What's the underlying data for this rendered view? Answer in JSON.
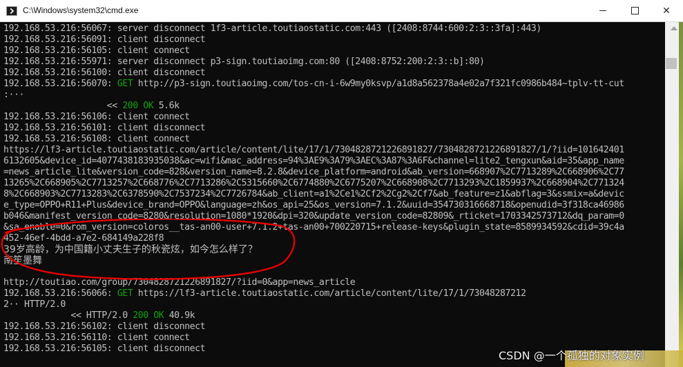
{
  "window": {
    "title": "C:\\Windows\\system32\\cmd.exe",
    "icon": "cmd-icon"
  },
  "console_lines": [
    {
      "text": "192.168.53.216:56067: server disconnect 1f3-article.toutiaostatic.com:443 ([2408:8744:600:2:3::3fa]:443)"
    },
    {
      "text": "192.168.53.216:56091: client disconnect"
    },
    {
      "text": "192.168.53.216:56105: client connect"
    },
    {
      "text": "192.168.53.216:55971: server disconnect p3-sign.toutiaoimg.com:80 ([2408:8752:200:2:3::b]:80)"
    },
    {
      "text": "192.168.53.216:56100: client disconnect"
    },
    {
      "prefix": "192.168.53.216:56070: ",
      "method": "GET",
      "text": " http://p3-sign.toutiaoimg.com/tos-cn-i-6w9my0ksvp/a1d8a562378a4e02a7f321fc0986b484~tplv-tt-cut"
    },
    {
      "text": ":···"
    },
    {
      "text": "                    << ",
      "status": "200 OK",
      "tail": " 5.6k"
    },
    {
      "text": "192.168.53.216:56106: client connect"
    },
    {
      "text": "192.168.53.216:56101: client disconnect"
    },
    {
      "text": "192.168.53.216:56108: client connect"
    },
    {
      "text": "https://lf3-article.toutiaostatic.com/article/content/lite/17/1/7304828721226891827/7304828721226891827/1/?iid=101642401"
    },
    {
      "text": "6132605&device_id=4077438183935038&ac=wifi&mac_address=94%3AE9%3A79%3AEC%3A87%3A6F&channel=lite2_tengxun&aid=35&app_name"
    },
    {
      "text": "=news_article_lite&version_code=828&version_name=8.2.8&device_platform=android&ab_version=668907%2C7713289%2C668906%2C77"
    },
    {
      "text": "13265%2C668905%2C7713257%2C668776%2C7713286%2C5315660%2C6774880%2C6775207%2C668908%2C7713293%2C1859937%2C668904%2C771324"
    },
    {
      "text": "8%2C668903%2C7713283%2C6378590%2C7537234%2C7726784&ab_client=a1%2Ce1%2Cf2%2Cg2%2Cf7&ab_feature=z1&abflag=3&ssmix=a&devic"
    },
    {
      "text": "e_type=OPPO+R11+Plus&device_brand=OPPO&language=zh&os_api=25&os_version=7.1.2&uuid=354730316668718&openudid=3f318ca46986"
    },
    {
      "text": "b046&manifest_version_code=8280&resolution=1080*1920&dpi=320&update_version_code=82809&_rticket=1703342573712&dq_param=0"
    },
    {
      "text": "&sa_enable=0&rom_version=coloros__tas-an00-user+7.1.2+tas-an00+700220715+release-keys&plugin_state=8589934592&cdid=39c4a"
    },
    {
      "text": "452-46ef-4bdd-a7e2-684149a228f8"
    },
    {
      "text": "39岁高龄，为中国籍小丈夫生子的秋瓷炫，如今怎么样了？",
      "cjk": true
    },
    {
      "text": "南笙墨舞",
      "cjk": true
    },
    {
      "text": ""
    },
    {
      "text": "http://toutiao.com/group/7304828721226891827/?iid=0&app=news_article"
    },
    {
      "prefix": "192.168.53.216:56066: ",
      "method": "GET",
      "text": " https://lf3-article.toutiaostatic.com/article/content/lite/17/1/73048287212"
    },
    {
      "text": "2·· HTTP/2.0"
    },
    {
      "text": "             << HTTP/2.0 ",
      "status": "200 OK",
      "tail": " 40.9k"
    },
    {
      "text": "192.168.53.216:56102: client disconnect"
    },
    {
      "text": "192.168.53.216:56110: client connect"
    },
    {
      "text": "192.168.53.216:56105: client disconnect"
    }
  ],
  "watermark": "CSDN @一个孤独的对象实例",
  "colors": {
    "console_bg": "#0c0c0c",
    "console_text": "#c0c0c0",
    "green": "#13a10e",
    "annotation_red": "#e60000"
  }
}
